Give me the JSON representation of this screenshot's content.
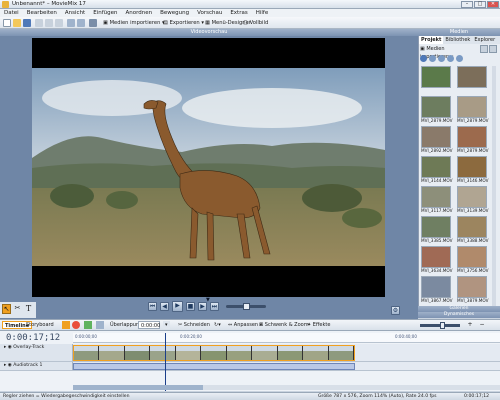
{
  "window": {
    "title": "Unbenannt* – MovieMix 17"
  },
  "menubar": [
    "Datei",
    "Bearbeiten",
    "Ansicht",
    "Einfügen",
    "Anordnen",
    "Bewegung",
    "Vorschau",
    "Extras",
    "Hilfe"
  ],
  "toolbar": {
    "import_label": "Medien importieren",
    "export_label": "Exportieren",
    "menu_design_label": "Menü-Designer",
    "fullscreen_label": "Vollbild"
  },
  "preview": {
    "header": "Videovorschau"
  },
  "media": {
    "header": "Medien",
    "tabs": [
      "Projekt",
      "Bibliothek",
      "Explorer"
    ],
    "import_label": "Medien importieren",
    "items": [
      {
        "label": "",
        "color": "#5b7a4a"
      },
      {
        "label": "",
        "color": "#7c6e5a"
      },
      {
        "label": "MVI_2879.MOV",
        "color": "#6d7d5f"
      },
      {
        "label": "MVI_2879.MOV",
        "color": "#a89b86"
      },
      {
        "label": "MVI_2892.MOV",
        "color": "#8a7a6a"
      },
      {
        "label": "MVI_2879.MOV",
        "color": "#9c6a4d"
      },
      {
        "label": "MVI_3144.MOV",
        "color": "#6e7a56"
      },
      {
        "label": "MVI_3146.MOV",
        "color": "#8c6a3e"
      },
      {
        "label": "MVI_3117.MOV",
        "color": "#8d8f7a"
      },
      {
        "label": "MVI_3139.MOV",
        "color": "#b0a592"
      },
      {
        "label": "MVI_3385.MOV",
        "color": "#6f7f62"
      },
      {
        "label": "MVI_3388.MOV",
        "color": "#9c855f"
      },
      {
        "label": "MVI_3634.MOV",
        "color": "#a06a55"
      },
      {
        "label": "MVI_3756.MOV",
        "color": "#b08a6b"
      },
      {
        "label": "MVI_3867.MOV",
        "color": "#7b8aa0"
      },
      {
        "label": "MVI_3879.MOV",
        "color": "#b09480"
      }
    ],
    "galleries_label": "Galerien",
    "dynamic_label": "Dynamisches"
  },
  "timeline": {
    "tabs": [
      "Timeline",
      "Storyboard"
    ],
    "overlay_label": "Überlappung",
    "overlay_value": "0:00:00",
    "cut_label": "Schneiden",
    "fit_label": "Anpassen",
    "pan_zoom_label": "Schwenk & Zoom",
    "effects_label": "Effekte",
    "timecode": "0:00:17;12",
    "ruler_labels": [
      "0:00:00;00",
      "0:00:20;00",
      "0:00:40;00"
    ],
    "tracks": [
      "Overlay-Track",
      "Audiotrack 1"
    ]
  },
  "status": {
    "hint": "Regler ziehen = Wiedergabegeschwindigkeit einstellen",
    "info": "Größe 787 x 576, Zoom 114% (Auto), Rate 24.0 fps",
    "time": "0:00:17;12"
  },
  "colors": {
    "accent": "#f0a020",
    "panel": "#6f86a6",
    "playhead": "#1b3f8a"
  }
}
